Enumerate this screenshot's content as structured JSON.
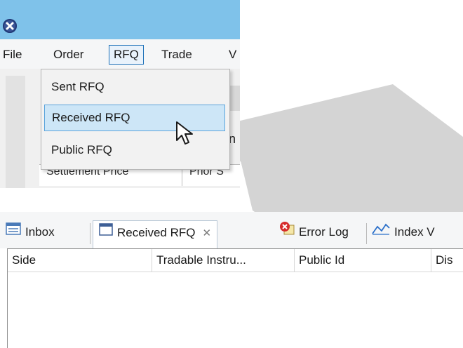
{
  "menubar": {
    "items": [
      "File",
      "Order",
      "RFQ",
      "Trade",
      "V"
    ],
    "open_menu": "RFQ"
  },
  "rfq_menu": {
    "items": [
      "Sent RFQ",
      "Received RFQ",
      "Public RFQ"
    ],
    "highlighted": "Received RFQ"
  },
  "background_window": {
    "header_text_1": "Settlement Price",
    "header_text_2": "Prior S",
    "partial_char": "n"
  },
  "tabs": {
    "items": [
      {
        "label": "Inbox",
        "icon": "inbox-table-icon"
      },
      {
        "label": "Received RFQ",
        "icon": "window-icon",
        "close": "✕",
        "active": true
      },
      {
        "label": "Error Log",
        "icon": "error-log-icon"
      },
      {
        "label": "Index V",
        "icon": "chart-line-icon"
      }
    ]
  },
  "table": {
    "columns": [
      "Side",
      "Tradable Instru...",
      "Public Id",
      "Dis"
    ]
  },
  "colors": {
    "titlebar": "#7fc2ea",
    "selection": "#cde6f7",
    "selection_border": "#5aa4dc",
    "arrow": "#d4d4d4"
  }
}
